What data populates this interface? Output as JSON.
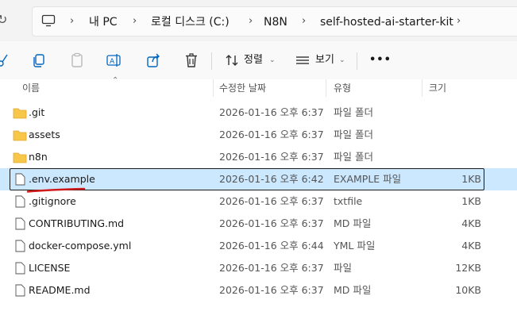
{
  "breadcrumb": [
    "내 PC",
    "로컬 디스크 (C:)",
    "N8N",
    "self-hosted-ai-starter-kit"
  ],
  "toolbar": {
    "sort_label": "정렬",
    "view_label": "보기",
    "more_label": "•••"
  },
  "columns": {
    "name": "이름",
    "date": "수정한 날짜",
    "type": "유형",
    "size": "크기"
  },
  "files": [
    {
      "name": ".git",
      "date": "2026-01-16 오후 6:37",
      "type": "파일 폴더",
      "size": "",
      "kind": "folder"
    },
    {
      "name": "assets",
      "date": "2026-01-16 오후 6:37",
      "type": "파일 폴더",
      "size": "",
      "kind": "folder"
    },
    {
      "name": "n8n",
      "date": "2026-01-16 오후 6:37",
      "type": "파일 폴더",
      "size": "",
      "kind": "folder"
    },
    {
      "name": ".env.example",
      "date": "2026-01-16 오후 6:42",
      "type": "EXAMPLE 파일",
      "size": "1KB",
      "kind": "file",
      "selected": true
    },
    {
      "name": ".gitignore",
      "date": "2026-01-16 오후 6:37",
      "type": "txtfile",
      "size": "1KB",
      "kind": "file"
    },
    {
      "name": "CONTRIBUTING.md",
      "date": "2026-01-16 오후 6:37",
      "type": "MD 파일",
      "size": "4KB",
      "kind": "file"
    },
    {
      "name": "docker-compose.yml",
      "date": "2026-01-16 오후 6:44",
      "type": "YML 파일",
      "size": "4KB",
      "kind": "file"
    },
    {
      "name": "LICENSE",
      "date": "2026-01-16 오후 6:37",
      "type": "파일",
      "size": "12KB",
      "kind": "file"
    },
    {
      "name": "README.md",
      "date": "2026-01-16 오후 6:37",
      "type": "MD 파일",
      "size": "10KB",
      "kind": "file"
    }
  ],
  "colors": {
    "folder": "#f8c74a",
    "selection": "#cce8ff",
    "annotation": "#d11a1a",
    "accent": "#0067c0"
  },
  "icons": [
    "refresh-icon",
    "pc-icon",
    "chevron-right-icon",
    "cut-icon",
    "copy-icon",
    "paste-icon",
    "rename-icon",
    "share-icon",
    "delete-icon",
    "sort-icon",
    "view-icon",
    "more-icon",
    "folder-icon",
    "file-icon"
  ]
}
